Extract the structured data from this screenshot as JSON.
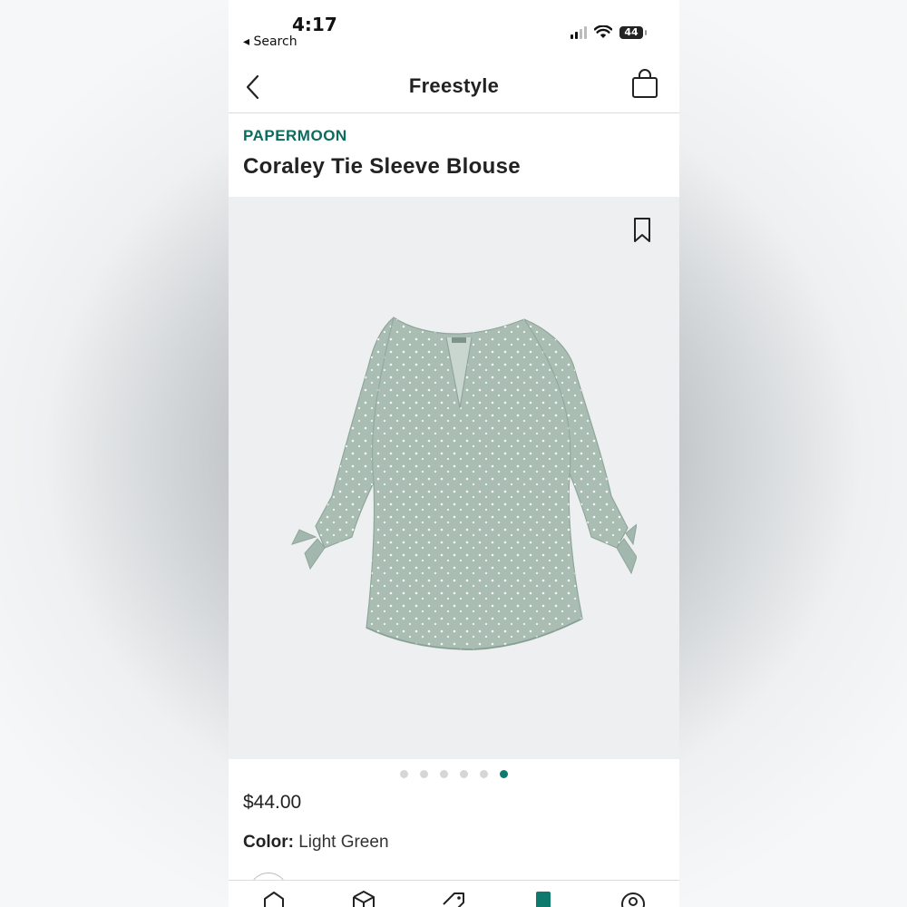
{
  "status_bar": {
    "time": "4:17",
    "back_label": "◂ Search",
    "battery": "44"
  },
  "nav": {
    "title": "Freestyle",
    "back_icon": "chevron-left-icon",
    "bag_icon": "shopping-bag-icon"
  },
  "product": {
    "brand": "PAPERMOON",
    "name": "Coraley Tie Sleeve Blouse",
    "price": "$44.00",
    "color_label": "Color:",
    "color_value": "Light Green",
    "image_count": 6,
    "active_image_index": 6,
    "bookmark_icon": "bookmark-icon"
  },
  "colors": {
    "accent": "#0d7a6d",
    "brand_text": "#0d6b5e",
    "image_bg": "#eeeff0",
    "blouse": "#a9bdb3"
  },
  "tab_bar": {
    "icons": [
      "home-icon",
      "box-icon",
      "tag-icon",
      "freestyle-icon",
      "profile-icon"
    ],
    "active_index": 3
  }
}
